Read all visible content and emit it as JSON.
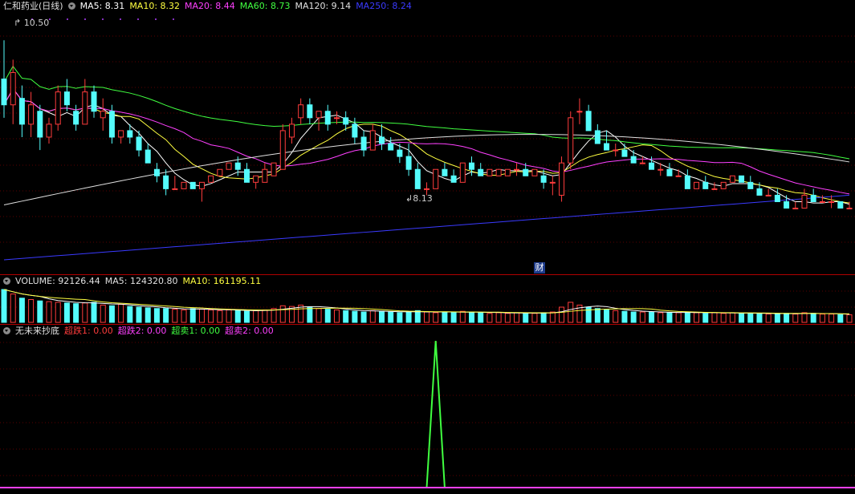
{
  "price_panel": {
    "stock_name": "仁和药业(日线)",
    "indicators": [
      {
        "label": "MA5: 8.31",
        "color": "#ffffff"
      },
      {
        "label": "MA10: 8.32",
        "color": "#ffff40"
      },
      {
        "label": "MA20: 8.44",
        "color": "#ff40ff"
      },
      {
        "label": "MA60: 8.73",
        "color": "#40ff40"
      },
      {
        "label": "MA120: 9.14",
        "color": "#e0e0e0"
      },
      {
        "label": "MA250: 8.24",
        "color": "#3a3aff"
      }
    ],
    "high_marker": "10.50",
    "low_marker": "8.13",
    "event_badge": "财"
  },
  "volume_panel": {
    "indicators": [
      {
        "label": "VOLUME: 92126.44",
        "color": "#e0e0e0"
      },
      {
        "label": "MA5: 124320.80",
        "color": "#e0e0e0"
      },
      {
        "label": "MA10: 161195.11",
        "color": "#ffff40"
      }
    ]
  },
  "signal_panel": {
    "name": "无未来抄底",
    "indicators": [
      {
        "label": "超跌1: 0.00",
        "color": "#ff3c3c"
      },
      {
        "label": "超跌2: 0.00",
        "color": "#ff40ff"
      },
      {
        "label": "超卖1: 0.00",
        "color": "#40ff40"
      },
      {
        "label": "超卖2: 0.00",
        "color": "#ff40ff"
      }
    ]
  },
  "chart_data": {
    "type": "candlestick",
    "colors": {
      "up": "#ff3c3c",
      "down": "#54fcfc",
      "ma5": "#ffffff",
      "ma10": "#ffff40",
      "ma20": "#ff40ff",
      "ma60": "#40ff40",
      "ma120": "#e0e0e0",
      "ma250": "#3a3aff",
      "signal": "#40ff40",
      "baseline": "#ff40ff"
    },
    "price_range": [
      7.0,
      10.9
    ],
    "candles": [
      [
        9.9,
        10.5,
        9.3,
        9.5
      ],
      [
        9.5,
        10.2,
        9.2,
        10.0
      ],
      [
        9.6,
        9.8,
        9.0,
        9.2
      ],
      [
        9.2,
        9.7,
        9.0,
        9.5
      ],
      [
        9.4,
        9.5,
        8.8,
        9.0
      ],
      [
        9.0,
        9.3,
        8.9,
        9.2
      ],
      [
        9.2,
        9.8,
        9.1,
        9.7
      ],
      [
        9.7,
        9.9,
        9.4,
        9.5
      ],
      [
        9.4,
        9.5,
        9.1,
        9.2
      ],
      [
        9.2,
        9.9,
        9.2,
        9.7
      ],
      [
        9.7,
        9.8,
        9.3,
        9.4
      ],
      [
        9.3,
        9.6,
        9.1,
        9.4
      ],
      [
        9.4,
        9.5,
        8.9,
        9.0
      ],
      [
        9.0,
        9.1,
        8.9,
        9.1
      ],
      [
        9.1,
        9.2,
        8.9,
        9.0
      ],
      [
        9.0,
        9.1,
        8.7,
        8.8
      ],
      [
        8.8,
        8.9,
        8.6,
        8.6
      ],
      [
        8.5,
        8.6,
        8.3,
        8.4
      ],
      [
        8.4,
        8.5,
        8.1,
        8.2
      ],
      [
        8.2,
        8.4,
        8.2,
        8.2
      ],
      [
        8.2,
        8.3,
        8.2,
        8.3
      ],
      [
        8.3,
        8.3,
        8.2,
        8.2
      ],
      [
        8.2,
        8.3,
        8.0,
        8.3
      ],
      [
        8.3,
        8.4,
        8.3,
        8.4
      ],
      [
        8.4,
        8.5,
        8.4,
        8.5
      ],
      [
        8.5,
        8.6,
        8.5,
        8.6
      ],
      [
        8.6,
        8.7,
        8.4,
        8.5
      ],
      [
        8.5,
        8.6,
        8.3,
        8.3
      ],
      [
        8.3,
        8.4,
        8.2,
        8.4
      ],
      [
        8.3,
        8.6,
        8.3,
        8.5
      ],
      [
        8.4,
        8.6,
        8.4,
        8.6
      ],
      [
        8.5,
        9.2,
        8.5,
        9.1
      ],
      [
        9.0,
        9.3,
        8.9,
        9.2
      ],
      [
        9.3,
        9.6,
        9.2,
        9.5
      ],
      [
        9.5,
        9.6,
        9.2,
        9.3
      ],
      [
        9.3,
        9.4,
        9.1,
        9.4
      ],
      [
        9.4,
        9.5,
        9.1,
        9.2
      ],
      [
        9.3,
        9.4,
        9.2,
        9.3
      ],
      [
        9.3,
        9.4,
        9.1,
        9.2
      ],
      [
        9.2,
        9.3,
        8.9,
        9.0
      ],
      [
        9.0,
        9.1,
        8.7,
        8.8
      ],
      [
        8.8,
        9.2,
        8.8,
        9.1
      ],
      [
        9.0,
        9.2,
        8.8,
        8.9
      ],
      [
        8.9,
        9.0,
        8.8,
        8.8
      ],
      [
        8.8,
        8.9,
        8.6,
        8.7
      ],
      [
        8.7,
        8.9,
        8.4,
        8.5
      ],
      [
        8.5,
        8.6,
        8.2,
        8.2
      ],
      [
        8.2,
        8.3,
        8.1,
        8.2
      ],
      [
        8.2,
        8.5,
        8.2,
        8.5
      ],
      [
        8.5,
        8.6,
        8.4,
        8.4
      ],
      [
        8.4,
        8.5,
        8.3,
        8.3
      ],
      [
        8.3,
        8.6,
        8.3,
        8.6
      ],
      [
        8.6,
        8.7,
        8.4,
        8.5
      ],
      [
        8.5,
        8.6,
        8.4,
        8.4
      ],
      [
        8.4,
        8.5,
        8.4,
        8.5
      ],
      [
        8.4,
        8.5,
        8.4,
        8.5
      ],
      [
        8.4,
        8.5,
        8.4,
        8.5
      ],
      [
        8.5,
        8.6,
        8.4,
        8.5
      ],
      [
        8.5,
        8.6,
        8.4,
        8.4
      ],
      [
        8.4,
        8.5,
        8.4,
        8.5
      ],
      [
        8.4,
        8.5,
        8.2,
        8.3
      ],
      [
        8.3,
        8.4,
        8.1,
        8.3
      ],
      [
        8.1,
        8.7,
        8.0,
        8.6
      ],
      [
        8.6,
        9.4,
        8.5,
        9.3
      ],
      [
        9.4,
        9.6,
        9.2,
        9.4
      ],
      [
        9.4,
        9.5,
        9.1,
        9.1
      ],
      [
        9.1,
        9.2,
        8.9,
        8.9
      ],
      [
        8.9,
        9.1,
        8.8,
        8.8
      ],
      [
        8.8,
        8.9,
        8.7,
        8.8
      ],
      [
        8.8,
        8.9,
        8.7,
        8.7
      ],
      [
        8.7,
        8.8,
        8.6,
        8.6
      ],
      [
        8.6,
        8.7,
        8.6,
        8.6
      ],
      [
        8.6,
        8.7,
        8.5,
        8.5
      ],
      [
        8.5,
        8.6,
        8.4,
        8.5
      ],
      [
        8.5,
        8.6,
        8.4,
        8.4
      ],
      [
        8.4,
        8.5,
        8.4,
        8.4
      ],
      [
        8.4,
        8.5,
        8.2,
        8.2
      ],
      [
        8.2,
        8.3,
        8.2,
        8.3
      ],
      [
        8.3,
        8.4,
        8.2,
        8.2
      ],
      [
        8.2,
        8.3,
        8.2,
        8.2
      ],
      [
        8.2,
        8.3,
        8.2,
        8.3
      ],
      [
        8.3,
        8.4,
        8.3,
        8.4
      ],
      [
        8.4,
        8.4,
        8.3,
        8.3
      ],
      [
        8.3,
        8.4,
        8.2,
        8.2
      ],
      [
        8.2,
        8.3,
        8.1,
        8.1
      ],
      [
        8.1,
        8.2,
        8.1,
        8.1
      ],
      [
        8.1,
        8.2,
        8.0,
        8.0
      ],
      [
        8.0,
        8.1,
        7.9,
        7.9
      ],
      [
        7.9,
        8.0,
        7.9,
        7.9
      ],
      [
        7.9,
        8.2,
        7.9,
        8.1
      ],
      [
        8.1,
        8.2,
        8.0,
        8.0
      ],
      [
        8.0,
        8.1,
        8.0,
        8.0
      ],
      [
        8.0,
        8.1,
        7.9,
        8.0
      ],
      [
        8.0,
        8.0,
        7.9,
        7.9
      ],
      [
        7.9,
        8.0,
        7.9,
        7.9
      ]
    ],
    "volume": [
      95,
      82,
      70,
      66,
      62,
      60,
      58,
      56,
      54,
      56,
      58,
      50,
      48,
      52,
      46,
      44,
      42,
      40,
      40,
      38,
      36,
      40,
      38,
      36,
      34,
      36,
      34,
      32,
      34,
      36,
      40,
      48,
      46,
      50,
      44,
      40,
      38,
      36,
      34,
      32,
      30,
      34,
      32,
      30,
      28,
      30,
      34,
      30,
      28,
      30,
      28,
      32,
      30,
      28,
      26,
      28,
      26,
      28,
      26,
      26,
      28,
      30,
      44,
      58,
      50,
      44,
      40,
      36,
      34,
      32,
      30,
      30,
      30,
      28,
      28,
      28,
      30,
      28,
      26,
      28,
      26,
      28,
      26,
      26,
      26,
      24,
      26,
      26,
      24,
      28,
      26,
      24,
      24,
      22,
      22
    ],
    "signal_spike_index": 48,
    "signal_value": 1.0
  }
}
